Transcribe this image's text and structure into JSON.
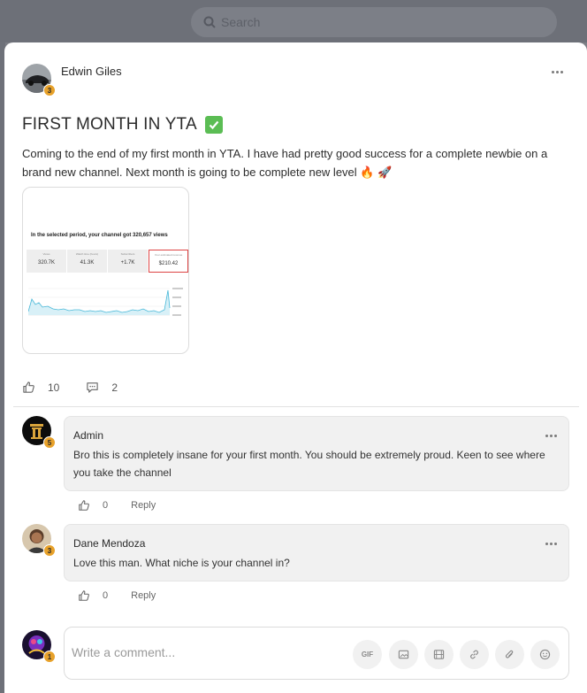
{
  "background": {
    "search_placeholder": "Search"
  },
  "post": {
    "author": "Edwin Giles",
    "author_level": "3",
    "title": "FIRST MONTH IN YTA",
    "body": "Coming to the end of my first month in YTA. I have had pretty good success for a complete newbie on a brand new channel. Next month is going to be complete new level 🔥 🚀",
    "image": {
      "heading": "In the selected period, your channel got 320,657 views",
      "stats": [
        {
          "label": "Views",
          "value": "320.7K"
        },
        {
          "label": "Watch time (hours)",
          "value": "41.3K"
        },
        {
          "label": "Subscribers",
          "value": "+1.7K"
        },
        {
          "label": "Your estimated revenue",
          "value": "$210.42"
        }
      ]
    },
    "likes": "10",
    "comments_count": "2"
  },
  "comments": [
    {
      "author": "Admin",
      "level": "5",
      "text": "Bro this is completely insane for your first month. You should be extremely proud. Keen to see where you take the channel",
      "likes": "0",
      "reply_label": "Reply"
    },
    {
      "author": "Dane Mendoza",
      "level": "3",
      "text": "Love this man. What niche is your channel in?",
      "likes": "0",
      "reply_label": "Reply"
    }
  ],
  "composer": {
    "level": "1",
    "placeholder": "Write a comment...",
    "gif_label": "GIF"
  },
  "colors": {
    "badge": "#e7a12a",
    "check": "#5bbd54",
    "overlay": "#7d7f86"
  }
}
